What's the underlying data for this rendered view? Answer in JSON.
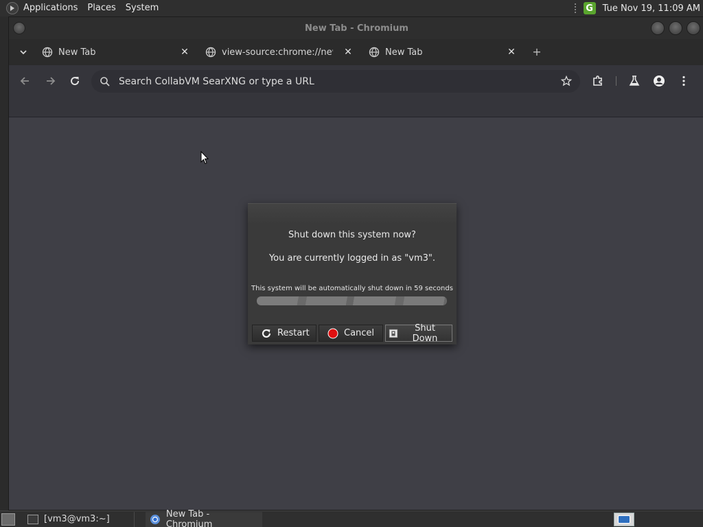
{
  "top_panel": {
    "menus": [
      "Applications",
      "Places",
      "System"
    ],
    "update_badge": "G",
    "clock": "Tue Nov 19, 11:09 AM"
  },
  "window": {
    "title": "New Tab - Chromium",
    "tabs": [
      {
        "title": "New Tab"
      },
      {
        "title": "view-source:chrome://new-t"
      },
      {
        "title": "New Tab"
      }
    ],
    "close_glyph": "✕",
    "new_tab_glyph": "+",
    "omnibox": {
      "placeholder": "Search CollabVM SearXNG or type a URL"
    }
  },
  "dialog": {
    "question": "Shut down this system now?",
    "logged_in": "You are currently logged in as \"vm3\".",
    "countdown": "This system will be automatically shut down in 59 seconds",
    "progress_fraction": 1.0,
    "buttons": {
      "restart": "Restart",
      "cancel": "Cancel",
      "shutdown": "Shut Down"
    }
  },
  "taskbar": {
    "tasks": [
      {
        "label": "[vm3@vm3:~]"
      },
      {
        "label": "New Tab - Chromium"
      }
    ]
  },
  "colors": {
    "accent_update": "#5aa52e",
    "cancel_red": "#e01010"
  }
}
